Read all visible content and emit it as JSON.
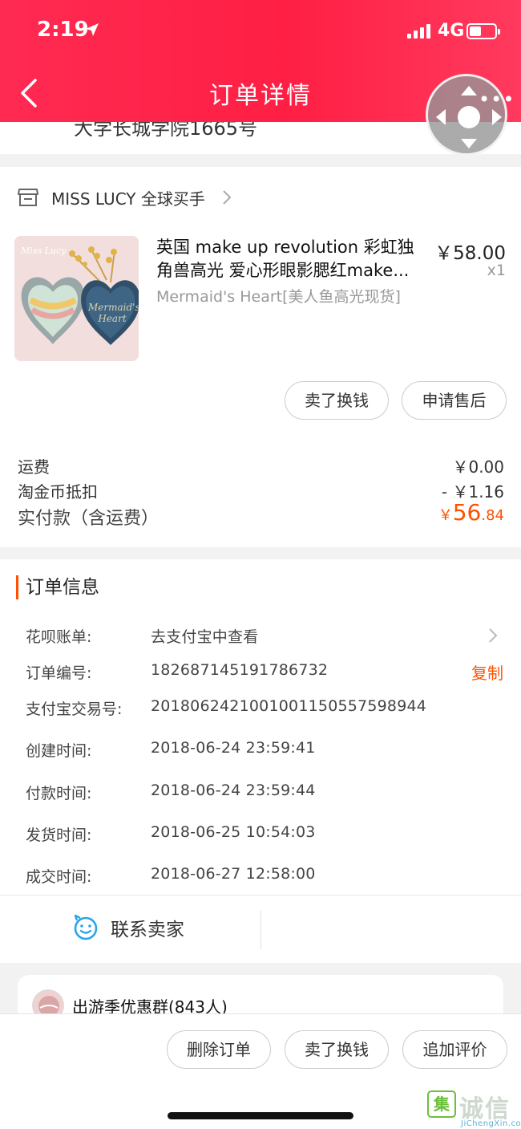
{
  "status_bar": {
    "time": "2:19",
    "network": "4G"
  },
  "header": {
    "title": "订单详情"
  },
  "address": {
    "partial_line": "大学长城学院1665号"
  },
  "shop": {
    "name": "MISS LUCY 全球买手"
  },
  "product": {
    "title_line1": "英国 make up revolution 彩虹独",
    "title_line2": "角兽高光 爱心形眼影腮红make...",
    "sku": "Mermaid's Heart[美人鱼高光现货]",
    "price": "￥58.00",
    "qty": "x1",
    "image_text": "Mermaid's Heart",
    "image_logo": "Miss Lucy"
  },
  "item_actions": {
    "sell_label": "卖了换钱",
    "after_sale_label": "申请售后"
  },
  "fees": [
    {
      "label": "运费",
      "value": "￥0.00"
    },
    {
      "label": "淘金币抵扣",
      "value": "- ￥1.16"
    }
  ],
  "total": {
    "label": "实付款（含运费）",
    "symbol": "￥",
    "integer": "56",
    "decimal": ".84"
  },
  "order_info": {
    "title": "订单信息",
    "rows": [
      {
        "label": "花呗账单:",
        "value": "去支付宝中查看"
      },
      {
        "label": "订单编号:",
        "value": "182687145191786732"
      },
      {
        "label": "支付宝交易号:",
        "value": "2018062421001001150557598944"
      },
      {
        "label": "创建时间:",
        "value": "2018-06-24 23:59:41"
      },
      {
        "label": "付款时间:",
        "value": "2018-06-24 23:59:44"
      },
      {
        "label": "发货时间:",
        "value": "2018-06-25 10:54:03"
      },
      {
        "label": "成交时间:",
        "value": "2018-06-27 12:58:00"
      }
    ],
    "copy_label": "复制"
  },
  "contact": {
    "label": "联系卖家"
  },
  "group": {
    "name": "出游季优惠群(843人)"
  },
  "bottom_actions": {
    "delete_label": "删除订单",
    "sell_label": "卖了换钱",
    "review_label": "追加评价"
  },
  "watermark": {
    "mark": "集",
    "text": "诚信",
    "sub": "JiChengXin.com"
  },
  "colors": {
    "header": "#ff2a52",
    "accent": "#ff5000"
  },
  "icons": [
    "location-arrow-icon",
    "signal-icon",
    "battery-icon",
    "back-arrow-icon",
    "assistive-touch-icon",
    "shop-icon",
    "chevron-right-icon",
    "smile-chat-icon"
  ]
}
